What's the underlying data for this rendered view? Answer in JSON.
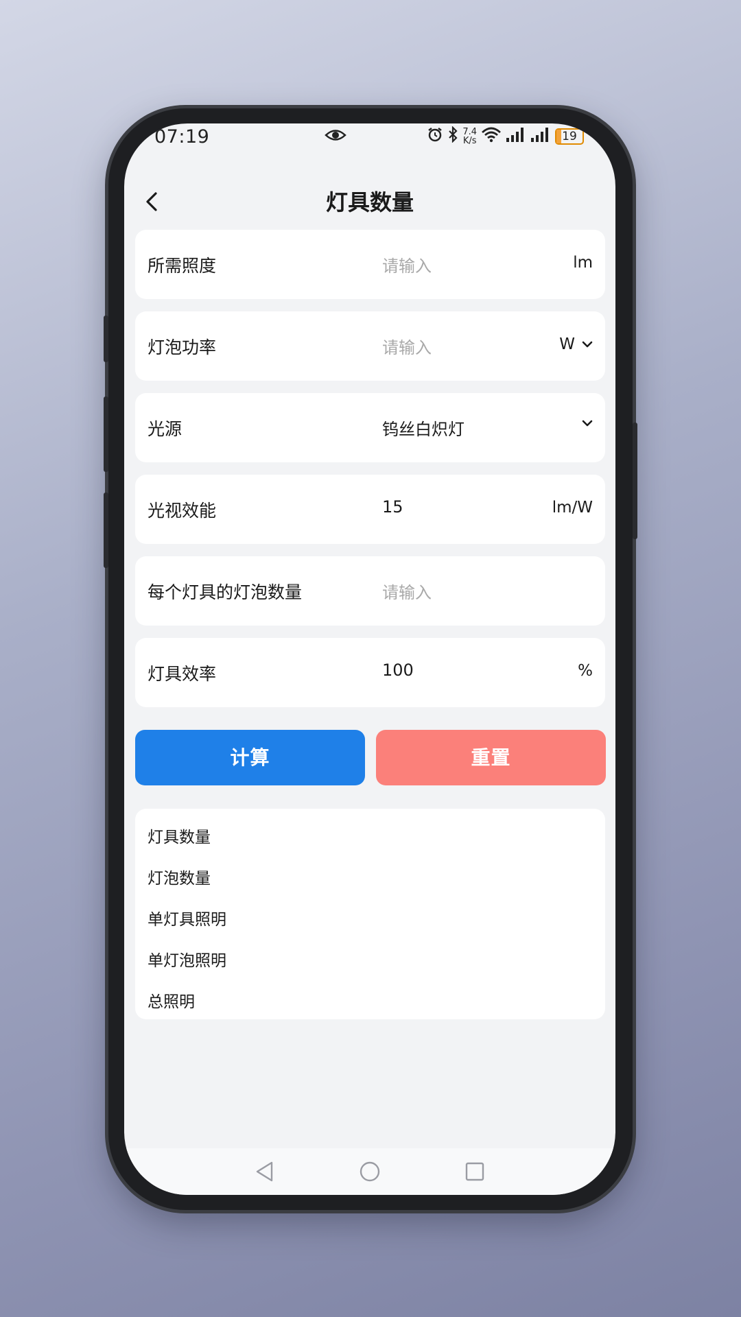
{
  "status_bar": {
    "time": "07:19",
    "net_speed_value": "7.4",
    "net_speed_unit": "K/s",
    "battery": "19",
    "icons": [
      "eye-icon",
      "alarm-icon",
      "bluetooth-icon",
      "wifi-icon",
      "signal-icon",
      "signal-icon",
      "battery-icon"
    ]
  },
  "header": {
    "title": "灯具数量",
    "back_icon": "chevron-left-icon"
  },
  "form": {
    "rows": [
      {
        "label": "所需照度",
        "value": "",
        "placeholder": "请输入",
        "unit": "lm"
      },
      {
        "label": "灯泡功率",
        "value": "",
        "placeholder": "请输入",
        "unit": "W",
        "unit_dropdown": true
      },
      {
        "label": "光源",
        "value": "钨丝白炽灯",
        "placeholder": "",
        "dropdown": true
      },
      {
        "label": "光视效能",
        "value": "15",
        "placeholder": "",
        "unit": "lm/W"
      },
      {
        "label": "每个灯具的灯泡数量",
        "value": "",
        "placeholder": "请输入",
        "unit": ""
      },
      {
        "label": "灯具效率",
        "value": "100",
        "placeholder": "",
        "unit": "%"
      }
    ]
  },
  "actions": {
    "calculate_label": "计算",
    "reset_label": "重置"
  },
  "results": {
    "labels": [
      "灯具数量",
      "灯泡数量",
      "单灯具照明",
      "单灯泡照明",
      "总照明"
    ]
  },
  "colors": {
    "calculate_button": "#1f80e8",
    "reset_button": "#fb807a",
    "screen_background": "#f2f3f5",
    "battery_accent": "#e08a00"
  },
  "system_nav": [
    "back-triangle-icon",
    "home-circle-icon",
    "recents-square-icon"
  ]
}
